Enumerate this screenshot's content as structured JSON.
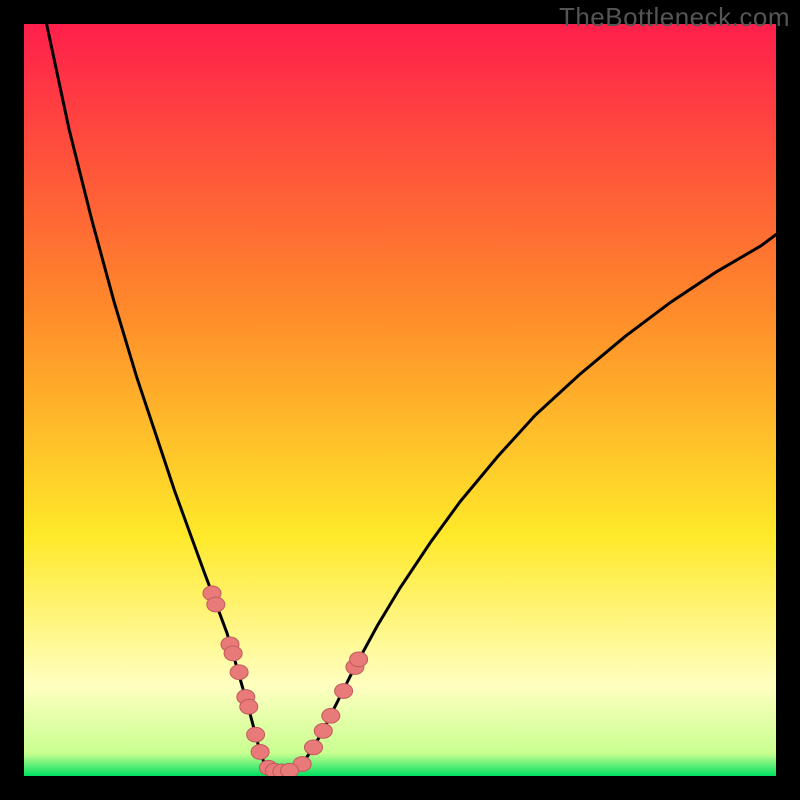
{
  "watermark": "TheBottleneck.com",
  "colors": {
    "gradient_top": "#ff1f4b",
    "gradient_mid1": "#ff8a2a",
    "gradient_mid2": "#ffe92a",
    "gradient_light": "#ffffc0",
    "gradient_green": "#00e060",
    "curve": "#000000",
    "marker_fill": "#e87a7a",
    "marker_stroke": "#c25a5a"
  },
  "chart_data": {
    "type": "line",
    "title": "",
    "xlabel": "",
    "ylabel": "",
    "xlim": [
      0,
      100
    ],
    "ylim": [
      0,
      100
    ],
    "curve_left": {
      "name": "left-branch",
      "x": [
        3,
        6,
        9,
        12,
        15,
        18,
        20,
        22,
        24,
        25.5,
        27,
        28,
        29,
        30,
        30.8,
        31.4,
        32
      ],
      "y": [
        100,
        86,
        74,
        63,
        53,
        44,
        38,
        32.5,
        27,
        23,
        19,
        15.5,
        12,
        8.5,
        5.5,
        3.2,
        1.6
      ]
    },
    "curve_bottom": {
      "name": "valley",
      "x": [
        32,
        33,
        34,
        35,
        36,
        37
      ],
      "y": [
        1.6,
        0.9,
        0.6,
        0.6,
        0.9,
        1.6
      ]
    },
    "curve_right": {
      "name": "right-branch",
      "x": [
        37,
        38.5,
        40,
        42,
        44,
        47,
        50,
        54,
        58,
        63,
        68,
        74,
        80,
        86,
        92,
        98,
        100
      ],
      "y": [
        1.6,
        3.8,
        6.5,
        10.5,
        14.5,
        20,
        25,
        31,
        36.5,
        42.5,
        48,
        53.5,
        58.5,
        63,
        67,
        70.5,
        72
      ]
    },
    "markers_left": {
      "name": "left-markers",
      "x": [
        25.0,
        25.5,
        27.4,
        27.8,
        28.6,
        29.5,
        29.9,
        30.8,
        31.4
      ],
      "y": [
        24.3,
        22.8,
        17.5,
        16.3,
        13.8,
        10.5,
        9.2,
        5.5,
        3.2
      ]
    },
    "markers_right": {
      "name": "right-markers",
      "x": [
        37.0,
        38.5,
        39.8,
        40.8,
        42.5,
        44.0,
        44.5
      ],
      "y": [
        1.6,
        3.8,
        6.0,
        8.0,
        11.3,
        14.5,
        15.5
      ]
    },
    "markers_bottom": {
      "name": "bottom-markers",
      "x": [
        32.5,
        33.3,
        34.3,
        35.3
      ],
      "y": [
        1.1,
        0.7,
        0.6,
        0.7
      ]
    }
  }
}
